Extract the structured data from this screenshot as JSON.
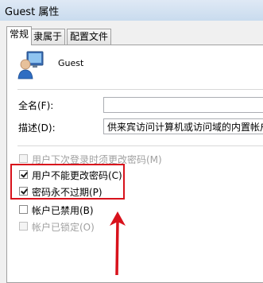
{
  "window": {
    "title": "Guest 属性"
  },
  "tabs": [
    {
      "label": "常规",
      "active": true
    },
    {
      "label": "隶属于",
      "active": false
    },
    {
      "label": "配置文件",
      "active": false
    }
  ],
  "user": {
    "name": "Guest",
    "icon": "user-account-icon"
  },
  "fields": {
    "full_name_label": "全名(F):",
    "full_name_value": "",
    "description_label": "描述(D):",
    "description_value": "供来宾访问计算机或访问域的内置帐户"
  },
  "options": [
    {
      "label": "用户下次登录时须更改密码(M)",
      "checked": false,
      "disabled": true
    },
    {
      "label": "用户不能更改密码(C)",
      "checked": true,
      "disabled": false
    },
    {
      "label": "密码永不过期(P)",
      "checked": true,
      "disabled": false
    },
    {
      "label": "帐户已禁用(B)",
      "checked": false,
      "disabled": false
    },
    {
      "label": "帐户已锁定(O)",
      "checked": false,
      "disabled": true
    }
  ],
  "annotation": {
    "color": "#d8121c"
  }
}
